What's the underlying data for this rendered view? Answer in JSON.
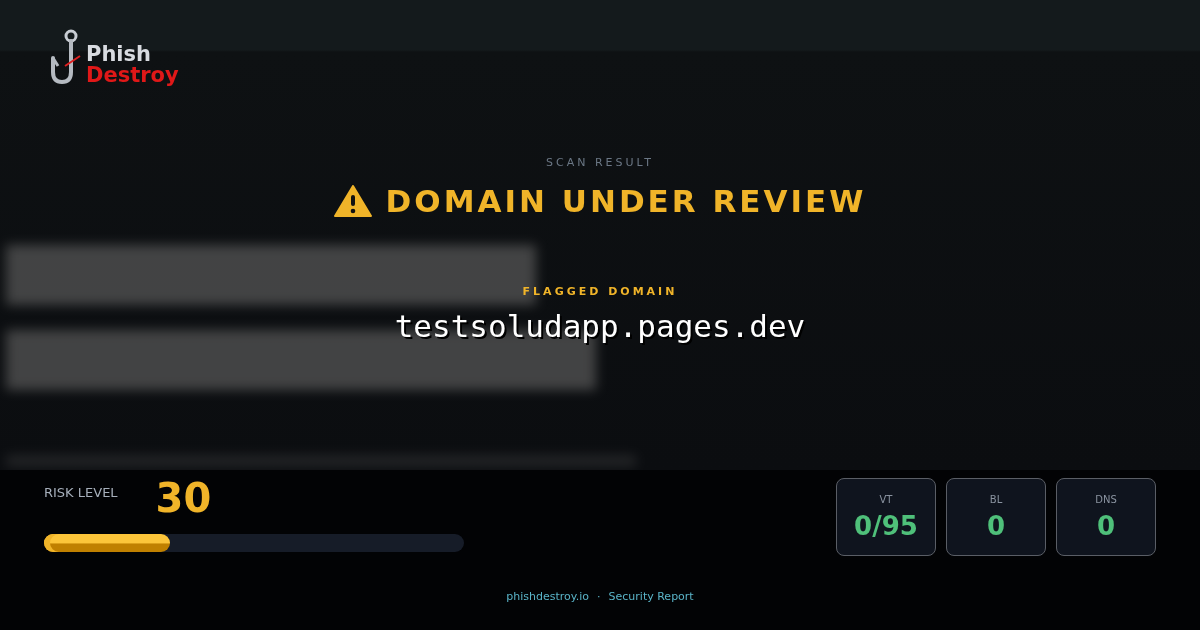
{
  "logo": {
    "line_1": "Phish",
    "line_2": "Destroy"
  },
  "scan": {
    "eyebrow": "SCAN RESULT",
    "status": "DOMAIN UNDER REVIEW",
    "kind": "review"
  },
  "domain": {
    "label": "FLAGGED DOMAIN",
    "value": "testsoludapp.pages.dev"
  },
  "risk": {
    "label": "RISK LEVEL",
    "score": "30",
    "level": 0.3
  },
  "stats": [
    {
      "label": "VT",
      "value": "0/95"
    },
    {
      "label": "BL",
      "value": "0"
    },
    {
      "label": "DNS",
      "value": "0"
    }
  ],
  "footer": {
    "site": "phishdestroy.io",
    "separator": "·",
    "title": "Security Report"
  }
}
